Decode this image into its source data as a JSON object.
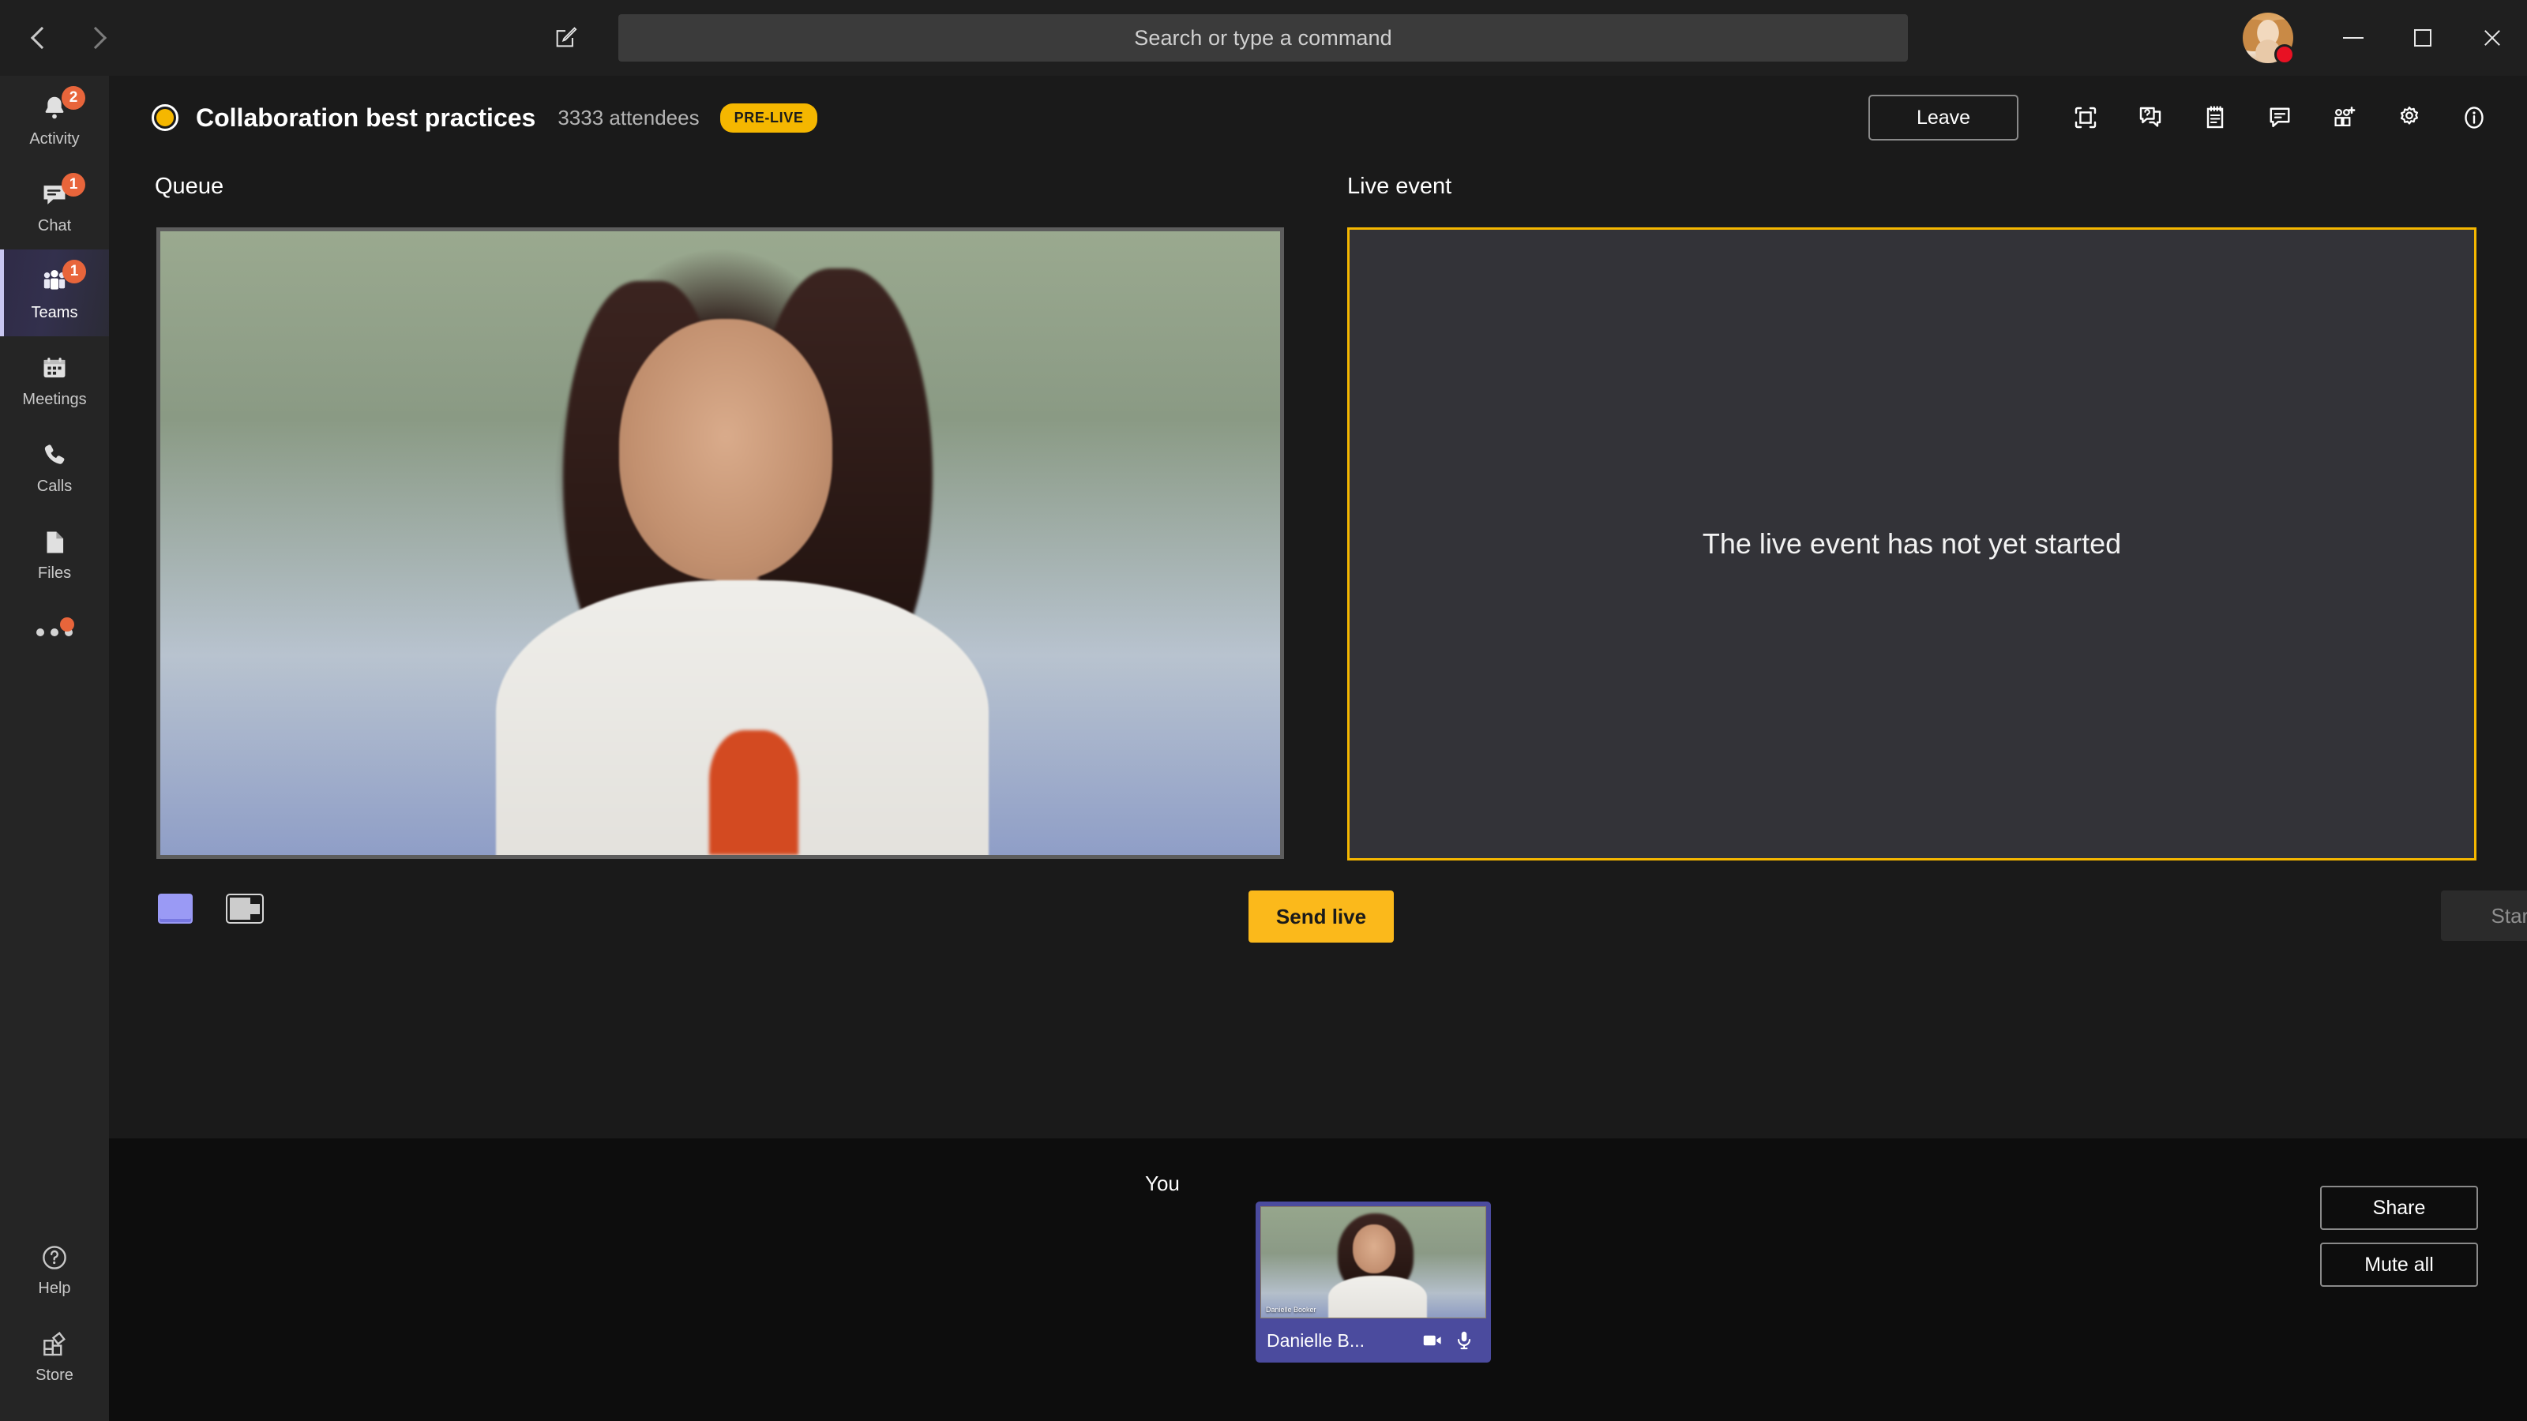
{
  "titlebar": {
    "back_label": "Back",
    "forward_label": "Forward",
    "compose_icon": "compose-icon",
    "search_placeholder": "Search or type a command",
    "avatar_name": "User avatar",
    "presence": "busy",
    "minimize_label": "Minimize",
    "maximize_label": "Maximize",
    "close_label": "Close"
  },
  "rail": {
    "items": [
      {
        "label": "Activity",
        "icon": "bell-icon",
        "badge": "2",
        "active": false
      },
      {
        "label": "Chat",
        "icon": "chat-icon",
        "badge": "1",
        "active": false
      },
      {
        "label": "Teams",
        "icon": "teams-icon",
        "badge": "1",
        "active": true
      },
      {
        "label": "Meetings",
        "icon": "calendar-icon",
        "badge": "",
        "active": false
      },
      {
        "label": "Calls",
        "icon": "phone-icon",
        "badge": "",
        "active": false
      },
      {
        "label": "Files",
        "icon": "files-icon",
        "badge": "",
        "active": false
      }
    ],
    "more_label": "More apps",
    "bottom": [
      {
        "label": "Help",
        "icon": "help-icon"
      },
      {
        "label": "Store",
        "icon": "store-icon"
      }
    ]
  },
  "header": {
    "status_color": "#f5b700",
    "title": "Collaboration best practices",
    "attendees": "3333 attendees",
    "state_badge": "PRE-LIVE",
    "leave_label": "Leave",
    "icons": [
      {
        "name": "full-screen-icon",
        "title": "Full screen"
      },
      {
        "name": "qna-icon",
        "title": "Q&A"
      },
      {
        "name": "notes-icon",
        "title": "Meeting notes"
      },
      {
        "name": "chat-icon",
        "title": "Show conversation"
      },
      {
        "name": "add-people-icon",
        "title": "Add participants"
      },
      {
        "name": "settings-icon",
        "title": "Device settings"
      },
      {
        "name": "info-icon",
        "title": "Event info"
      }
    ]
  },
  "stage": {
    "queue": {
      "title": "Queue",
      "video_alt": "Queued presenter video",
      "layouts": [
        {
          "name": "layout-single",
          "active": true
        },
        {
          "name": "layout-side-by-side",
          "active": false
        }
      ],
      "send_live_label": "Send live"
    },
    "live": {
      "title": "Live event",
      "message": "The live event has not yet started",
      "start_label": "Start",
      "start_disabled": true,
      "border_color": "#f5b700"
    }
  },
  "bottombar": {
    "you_label": "You",
    "tile": {
      "name": "Danielle B...",
      "video_name_overlay": "Danielle Booker",
      "camera_icon": "camera-icon",
      "mic_icon": "microphone-icon",
      "accent_color": "#4b4b9e"
    },
    "share_label": "Share",
    "mute_all_label": "Mute all"
  }
}
